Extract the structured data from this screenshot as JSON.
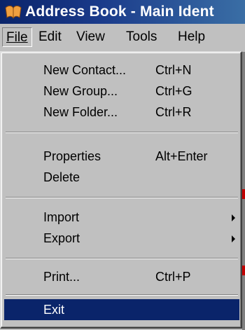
{
  "window": {
    "title": "Address Book - Main Ident"
  },
  "menubar": {
    "items": [
      {
        "label": "File",
        "mnemonic_index": 0
      },
      {
        "label": "Edit",
        "mnemonic_index": 0
      },
      {
        "label": "View",
        "mnemonic_index": 0
      },
      {
        "label": "Tools",
        "mnemonic_index": 0
      },
      {
        "label": "Help",
        "mnemonic_index": 0
      }
    ]
  },
  "file_menu": {
    "new_contact": {
      "label": "New Contact...",
      "shortcut": "Ctrl+N"
    },
    "new_group": {
      "label": "New Group...",
      "shortcut": "Ctrl+G"
    },
    "new_folder": {
      "label": "New Folder...",
      "shortcut": "Ctrl+R"
    },
    "properties": {
      "label": "Properties",
      "shortcut": "Alt+Enter"
    },
    "delete": {
      "label": "Delete"
    },
    "import": {
      "label": "Import"
    },
    "export": {
      "label": "Export"
    },
    "print": {
      "label": "Print...",
      "shortcut": "Ctrl+P"
    },
    "exit": {
      "label": "Exit"
    }
  },
  "colors": {
    "menu_face": "#c0c0c0",
    "selection": "#0a246a",
    "title_gradient_start": "#0a246a",
    "title_gradient_end": "#3a6ea5"
  },
  "icons": {
    "app": "address-book-icon",
    "submenu": "submenu-arrow-icon"
  }
}
